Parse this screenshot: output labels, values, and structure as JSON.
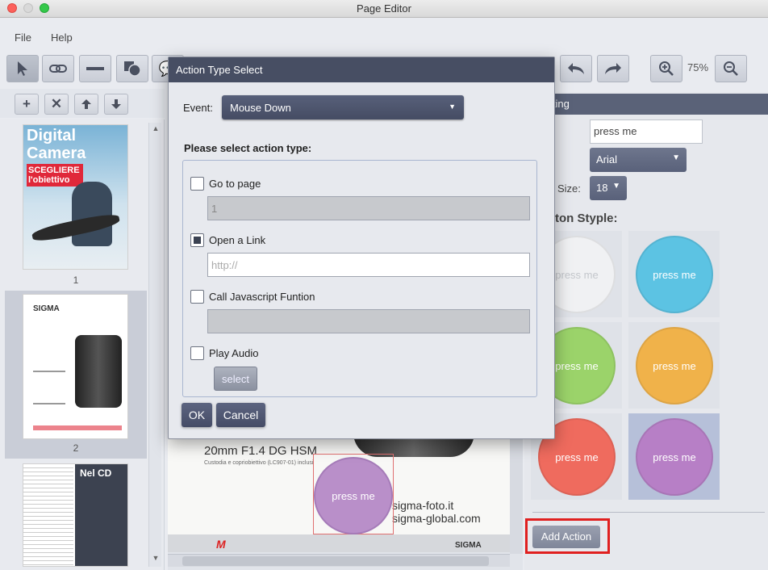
{
  "window": {
    "title": "Page Editor"
  },
  "menu": {
    "items": [
      "File",
      "Help"
    ]
  },
  "toolbar": {
    "zoom": "75%"
  },
  "pages": [
    {
      "number": "1",
      "cover_title": "Digital Camera",
      "cover_sub": "SCEGLIERE l'obiettivo"
    },
    {
      "number": "2",
      "brand": "SIGMA"
    },
    {
      "number": "",
      "cover_title": "Nel CD"
    }
  ],
  "canvas": {
    "product_title": "20mm F1.4 DG HSM",
    "caption": "Custodia e copriobiettivo (LC907-01) inclusi",
    "site1": "sigma-foto.it",
    "site2": "sigma-global.com",
    "button_text": "press me",
    "footer_brand": "SIGMA"
  },
  "right_panel": {
    "header": "etting",
    "text_value": "press me",
    "font": "Arial",
    "size_label": "Size:",
    "size": "18",
    "style_heading": "ton Styple:",
    "swatch_label": "press me",
    "swatches": [
      {
        "color": "#f0f1f3",
        "text_color": "#c4c7cc"
      },
      {
        "color": "#5cc3e3",
        "text_color": "#ffffff"
      },
      {
        "color": "#9bd36a",
        "text_color": "#ffffff"
      },
      {
        "color": "#f0b24a",
        "text_color": "#ffffff"
      },
      {
        "color": "#ef6b5e",
        "text_color": "#ffffff"
      },
      {
        "color": "#b77fc6",
        "text_color": "#ffffff"
      }
    ],
    "add_action": "Add Action"
  },
  "modal": {
    "title": "Action Type Select",
    "event_label": "Event:",
    "event_value": "Mouse Down",
    "prompt": "Please select action type:",
    "options": [
      {
        "label": "Go to page",
        "checked": false,
        "field": "1"
      },
      {
        "label": "Open a Link",
        "checked": true,
        "field_placeholder": "http://"
      },
      {
        "label": "Call Javascript Funtion",
        "checked": false,
        "field": ""
      },
      {
        "label": "Play Audio",
        "checked": false
      }
    ],
    "select_button": "select",
    "ok": "OK",
    "cancel": "Cancel"
  },
  "colors": {
    "accent": "#474e63",
    "highlight_border": "#e02020"
  }
}
